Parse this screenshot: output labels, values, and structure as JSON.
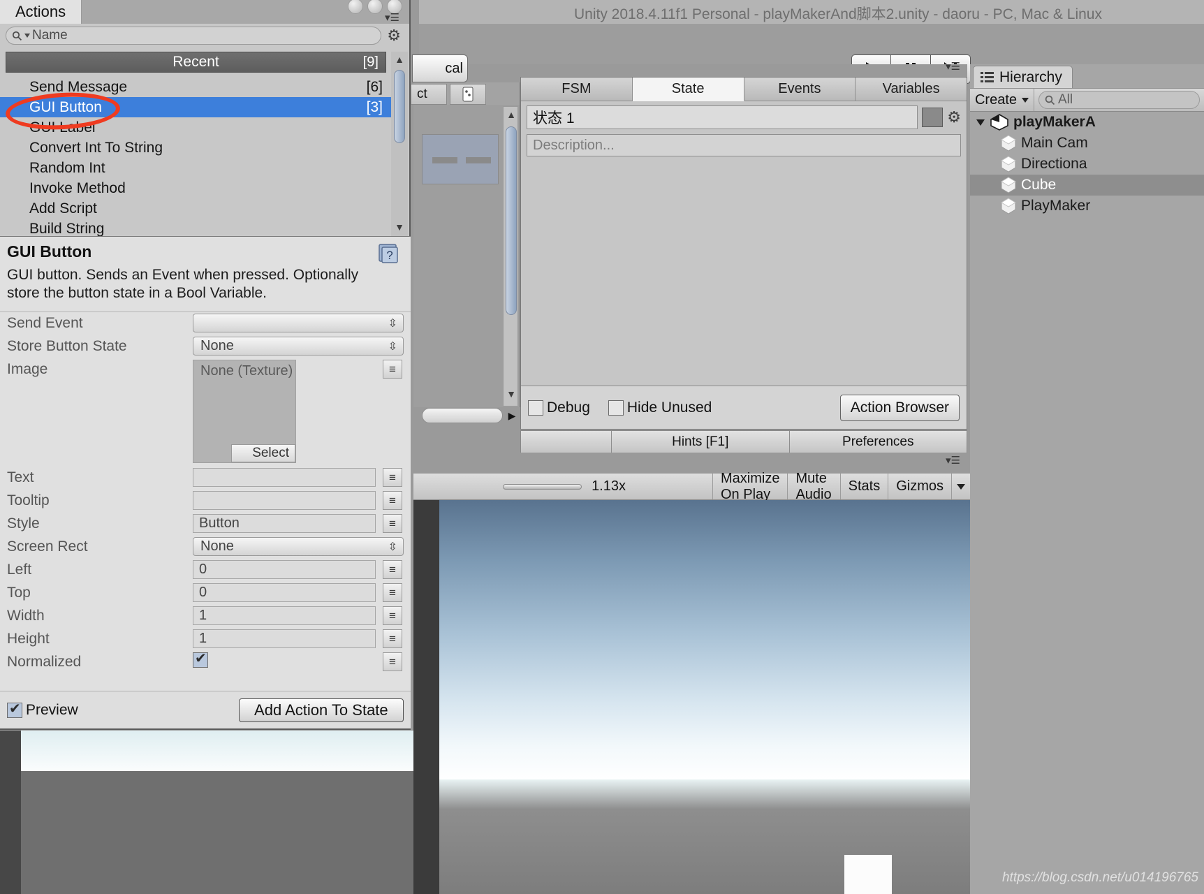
{
  "window": {
    "title": "Unity 2018.4.11f1 Personal - playMakerAnd脚本2.unity - daoru - PC, Mac & Linux"
  },
  "main_toolbar": {
    "local_button": "cal",
    "play_icon": "play-icon",
    "pause_icon": "pause-icon",
    "step_icon": "step-icon"
  },
  "inspector": {
    "tab_label": "ct"
  },
  "fsm_editor": {
    "tabs": [
      {
        "label": "FSM",
        "active": false
      },
      {
        "label": "State",
        "active": true
      },
      {
        "label": "Events",
        "active": false
      },
      {
        "label": "Variables",
        "active": false
      }
    ],
    "state_name": "状态 1",
    "description_placeholder": "Description...",
    "debug_label": "Debug",
    "debug_checked": false,
    "hide_unused_label": "Hide Unused",
    "hide_unused_checked": false,
    "action_browser_button": "Action Browser",
    "hints_label": "Hints [F1]",
    "preferences_label": "Preferences"
  },
  "hierarchy": {
    "tab_label": "Hierarchy",
    "create_label": "Create",
    "search_placeholder": "All",
    "items": [
      {
        "label": "playMakerA",
        "kind": "scene",
        "selected": false,
        "indent": 0
      },
      {
        "label": "Main Cam",
        "kind": "gameobject",
        "selected": false,
        "indent": 1
      },
      {
        "label": "Directiona",
        "kind": "gameobject",
        "selected": false,
        "indent": 1
      },
      {
        "label": "Cube",
        "kind": "gameobject",
        "selected": true,
        "indent": 1
      },
      {
        "label": "PlayMaker",
        "kind": "gameobject",
        "selected": false,
        "indent": 1
      }
    ]
  },
  "game_view": {
    "zoom_value": "1.13x",
    "maximize_on_play": "Maximize On Play",
    "mute_audio": "Mute Audio",
    "stats": "Stats",
    "gizmos": "Gizmos"
  },
  "actions_browser": {
    "window_tab": "Actions",
    "search_placeholder": "Name",
    "gear_icon": "gear-icon",
    "list_header": {
      "label": "Recent",
      "count": "[9]"
    },
    "list_items": [
      {
        "label": "Send Message",
        "count": "[6]",
        "selected": false
      },
      {
        "label": "GUI Button",
        "count": "[3]",
        "selected": true
      },
      {
        "label": "GUI Label",
        "count": "",
        "selected": false
      },
      {
        "label": "Convert Int To String",
        "count": "",
        "selected": false
      },
      {
        "label": "Random Int",
        "count": "",
        "selected": false
      },
      {
        "label": "Invoke Method",
        "count": "",
        "selected": false
      },
      {
        "label": "Add Script",
        "count": "",
        "selected": false
      },
      {
        "label": "Build String",
        "count": "",
        "selected": false
      }
    ],
    "detail": {
      "title": "GUI Button",
      "description": "GUI button. Sends an Event when pressed. Optionally store the button state in a Bool Variable.",
      "help_icon": "help-book-icon"
    },
    "fields": [
      {
        "label": "Send Event",
        "type": "popup",
        "value": ""
      },
      {
        "label": "Store Button State",
        "type": "popup",
        "value": "None"
      },
      {
        "label": "Image",
        "type": "object",
        "value": "None (Texture)",
        "select_label": "Select"
      },
      {
        "label": "Text",
        "type": "text",
        "value": ""
      },
      {
        "label": "Tooltip",
        "type": "text",
        "value": ""
      },
      {
        "label": "Style",
        "type": "text",
        "value": "Button"
      },
      {
        "label": "Screen Rect",
        "type": "popup",
        "value": "None"
      },
      {
        "label": "Left",
        "type": "text",
        "value": "0"
      },
      {
        "label": "Top",
        "type": "text",
        "value": "0"
      },
      {
        "label": "Width",
        "type": "text",
        "value": "1"
      },
      {
        "label": "Height",
        "type": "text",
        "value": "1"
      },
      {
        "label": "Normalized",
        "type": "checkbox",
        "value": "",
        "checked": true
      }
    ],
    "footer": {
      "preview_label": "Preview",
      "preview_checked": true,
      "add_action_label": "Add Action To State"
    }
  },
  "annotation": {
    "shape": "red-ellipse",
    "color": "#ef3b20"
  },
  "watermark": "https://blog.csdn.net/u014196765"
}
